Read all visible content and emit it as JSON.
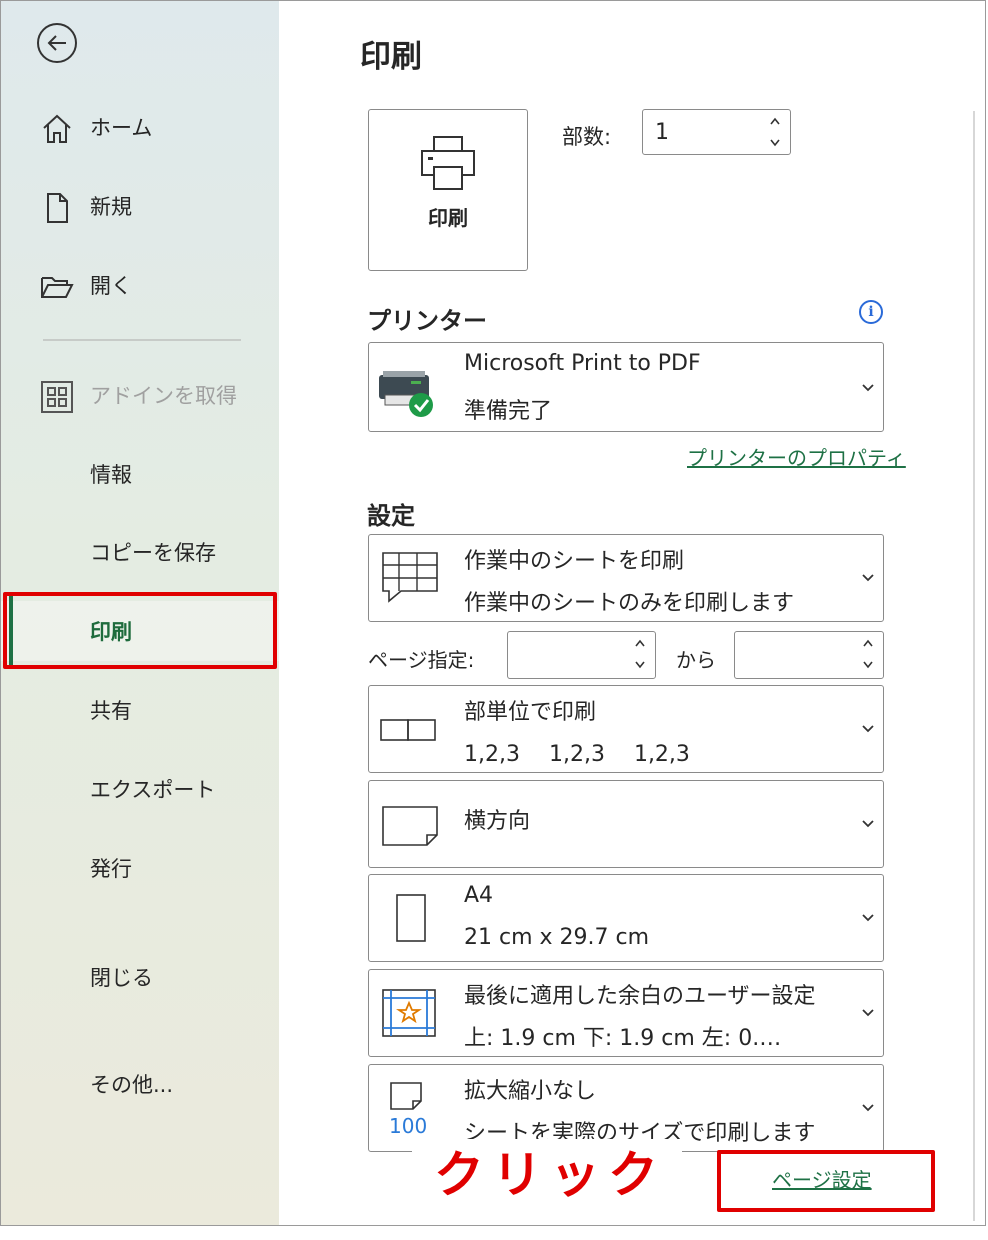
{
  "sidebar": {
    "items": [
      {
        "label": "ホーム",
        "icon": "home-icon"
      },
      {
        "label": "新規",
        "icon": "new-document-icon"
      },
      {
        "label": "開く",
        "icon": "folder-open-icon"
      },
      {
        "label": "アドインを取得",
        "icon": "add-ins-icon"
      },
      {
        "label": "情報"
      },
      {
        "label": "コピーを保存"
      },
      {
        "label": "印刷"
      },
      {
        "label": "共有"
      },
      {
        "label": "エクスポート"
      },
      {
        "label": "発行"
      },
      {
        "label": "閉じる"
      },
      {
        "label": "その他..."
      }
    ]
  },
  "main": {
    "title": "印刷",
    "print_button": "印刷",
    "copies": {
      "label": "部数:",
      "value": "1"
    },
    "printer": {
      "section": "プリンター",
      "name": "Microsoft Print to PDF",
      "status": "準備完了",
      "properties_link": "プリンターのプロパティ"
    },
    "settings": {
      "section": "設定",
      "scope": {
        "l1": "作業中のシートを印刷",
        "l2": "作業中のシートのみを印刷します"
      },
      "pages_label": "ページ指定:",
      "pages_to": "から",
      "collate": {
        "l1": "部単位で印刷",
        "l2": "1,2,3　 1,2,3　 1,2,3"
      },
      "orientation": {
        "l1": "横方向"
      },
      "paper": {
        "l1": "A4",
        "l2": "21 cm x 29.7 cm"
      },
      "margins": {
        "l1": "最後に適用した余白のユーザー設定",
        "l2": "上: 1.9 cm 下: 1.9 cm 左: 0.…"
      },
      "scaling": {
        "l1": "拡大縮小なし",
        "l2": "シートを実際のサイズで印刷します"
      },
      "page_setup_link": "ページ設定"
    }
  },
  "annotation": {
    "click_text": "クリック",
    "color": "#e00000"
  },
  "colors": {
    "accent": "#1e7145",
    "highlight": "#e00000"
  }
}
